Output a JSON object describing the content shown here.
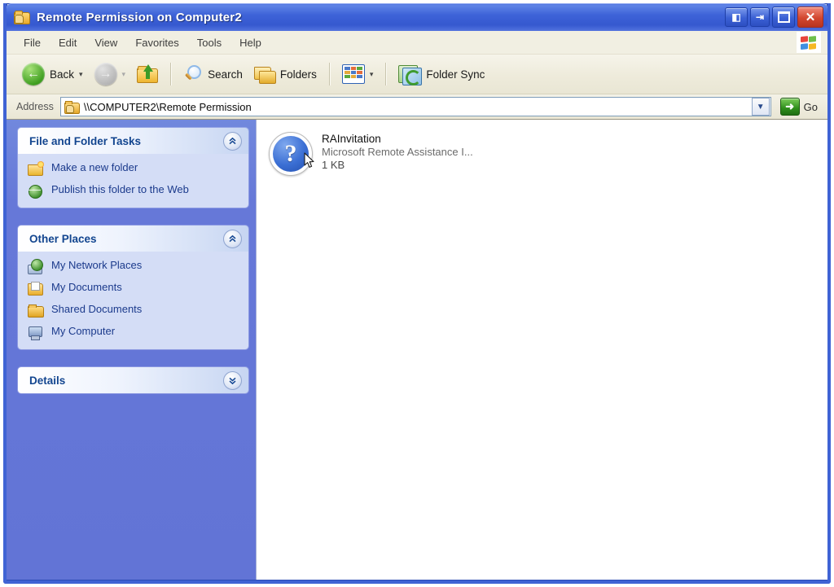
{
  "window": {
    "title": "Remote Permission on Computer2",
    "title_icon": "shared-folder-icon",
    "buttons": {
      "minimize_label": "◀▶",
      "restore_small_label": "⇥",
      "maximize_label": "",
      "close_label": "✕"
    }
  },
  "menu": {
    "items": [
      {
        "label": "File"
      },
      {
        "label": "Edit"
      },
      {
        "label": "View"
      },
      {
        "label": "Favorites"
      },
      {
        "label": "Tools"
      },
      {
        "label": "Help"
      }
    ],
    "brand_icon": "windows-flag-icon"
  },
  "toolbar": {
    "back_label": "Back",
    "back_caret": "▾",
    "forward_caret": "▾",
    "forward_icon": "forward-arrow-icon",
    "up_icon": "up-one-level-icon",
    "search_label": "Search",
    "folders_label": "Folders",
    "views_caret": "▾",
    "views_icon": "views-icon",
    "folder_sync_label": "Folder Sync",
    "folder_sync_icon": "folder-sync-icon"
  },
  "address": {
    "label": "Address",
    "value": "\\\\COMPUTER2\\Remote Permission",
    "icon": "shared-folder-icon",
    "dropdown_caret": "❯",
    "go_label": "Go",
    "go_arrow": "➜"
  },
  "sidebar": {
    "panels": [
      {
        "title": "File and Folder Tasks",
        "chevron": "expanded",
        "chevron_glyph": "≪",
        "items": [
          {
            "label": "Make a new folder",
            "icon": "new-folder-icon"
          },
          {
            "label": "Publish this folder to the Web",
            "icon": "publish-web-icon"
          }
        ]
      },
      {
        "title": "Other Places",
        "chevron": "expanded",
        "chevron_glyph": "≪",
        "items": [
          {
            "label": "My Network Places",
            "icon": "network-places-icon"
          },
          {
            "label": "My Documents",
            "icon": "my-documents-icon"
          },
          {
            "label": "Shared Documents",
            "icon": "shared-documents-icon"
          },
          {
            "label": "My Computer",
            "icon": "my-computer-icon"
          }
        ]
      },
      {
        "title": "Details",
        "chevron": "collapsed",
        "chevron_glyph": "≫",
        "items": []
      }
    ]
  },
  "content": {
    "files": [
      {
        "name": "RAInvitation",
        "type": "Microsoft Remote Assistance I...",
        "size": "1 KB",
        "icon": "question-mark-file-icon"
      }
    ]
  },
  "colors": {
    "title_blue": "#3e63d8",
    "frame_blue": "#3f63d4",
    "sidebar_blue": "#6678d8",
    "panel_body": "#d4ddf6",
    "panel_title_text": "#12458f",
    "toolbar_bg": "#ece9d8"
  }
}
